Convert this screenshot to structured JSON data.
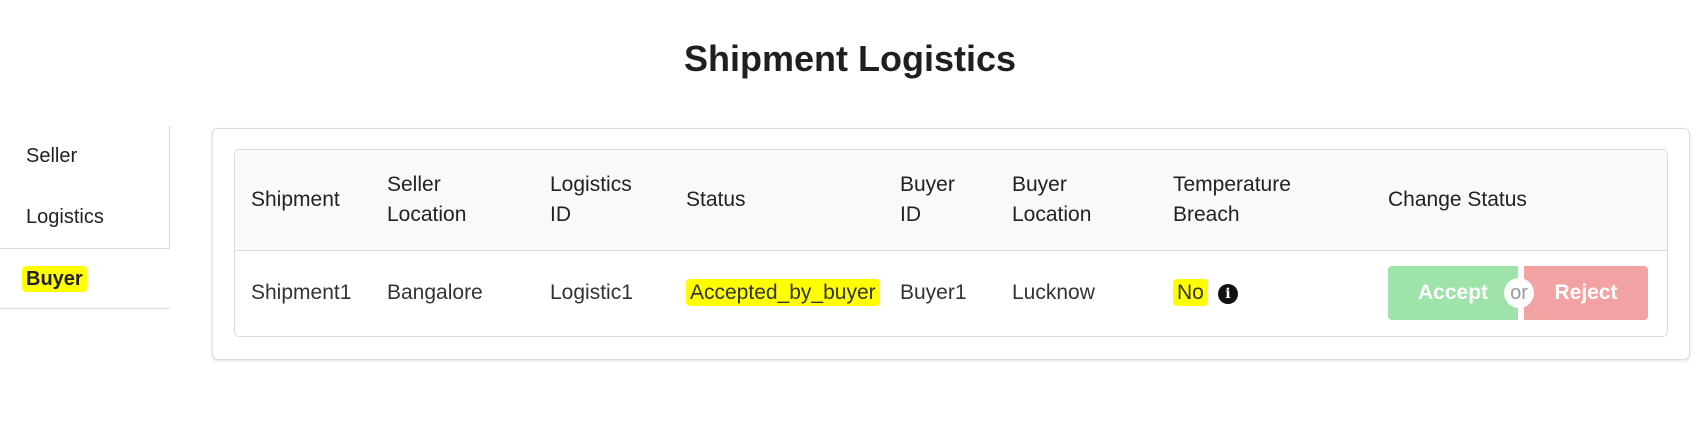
{
  "page": {
    "title": "Shipment Logistics"
  },
  "sidebar": {
    "items": [
      {
        "label": "Seller"
      },
      {
        "label": "Logistics"
      },
      {
        "label": "Buyer",
        "active": true
      }
    ]
  },
  "table": {
    "headers": {
      "shipment": "Shipment",
      "seller_location_1": "Seller",
      "seller_location_2": "Location",
      "logistics_id_1": "Logistics",
      "logistics_id_2": "ID",
      "status": "Status",
      "buyer_id_1": "Buyer",
      "buyer_id_2": "ID",
      "buyer_location_1": "Buyer",
      "buyer_location_2": "Location",
      "temperature_breach_1": "Temperature",
      "temperature_breach_2": "Breach",
      "change_status": "Change Status"
    },
    "rows": [
      {
        "shipment": "Shipment1",
        "seller_location": "Bangalore",
        "logistics_id": "Logistic1",
        "status": "Accepted_by_buyer",
        "buyer_id": "Buyer1",
        "buyer_location": "Lucknow",
        "temperature_breach": "No",
        "info_icon": "i",
        "accept_label": "Accept",
        "or_label": "or",
        "reject_label": "Reject"
      }
    ]
  },
  "colors": {
    "highlight": "#ffff00",
    "accept": "#9ee3a9",
    "reject": "#f2a2a2"
  },
  "icons": {
    "info": "info-circle-icon"
  }
}
